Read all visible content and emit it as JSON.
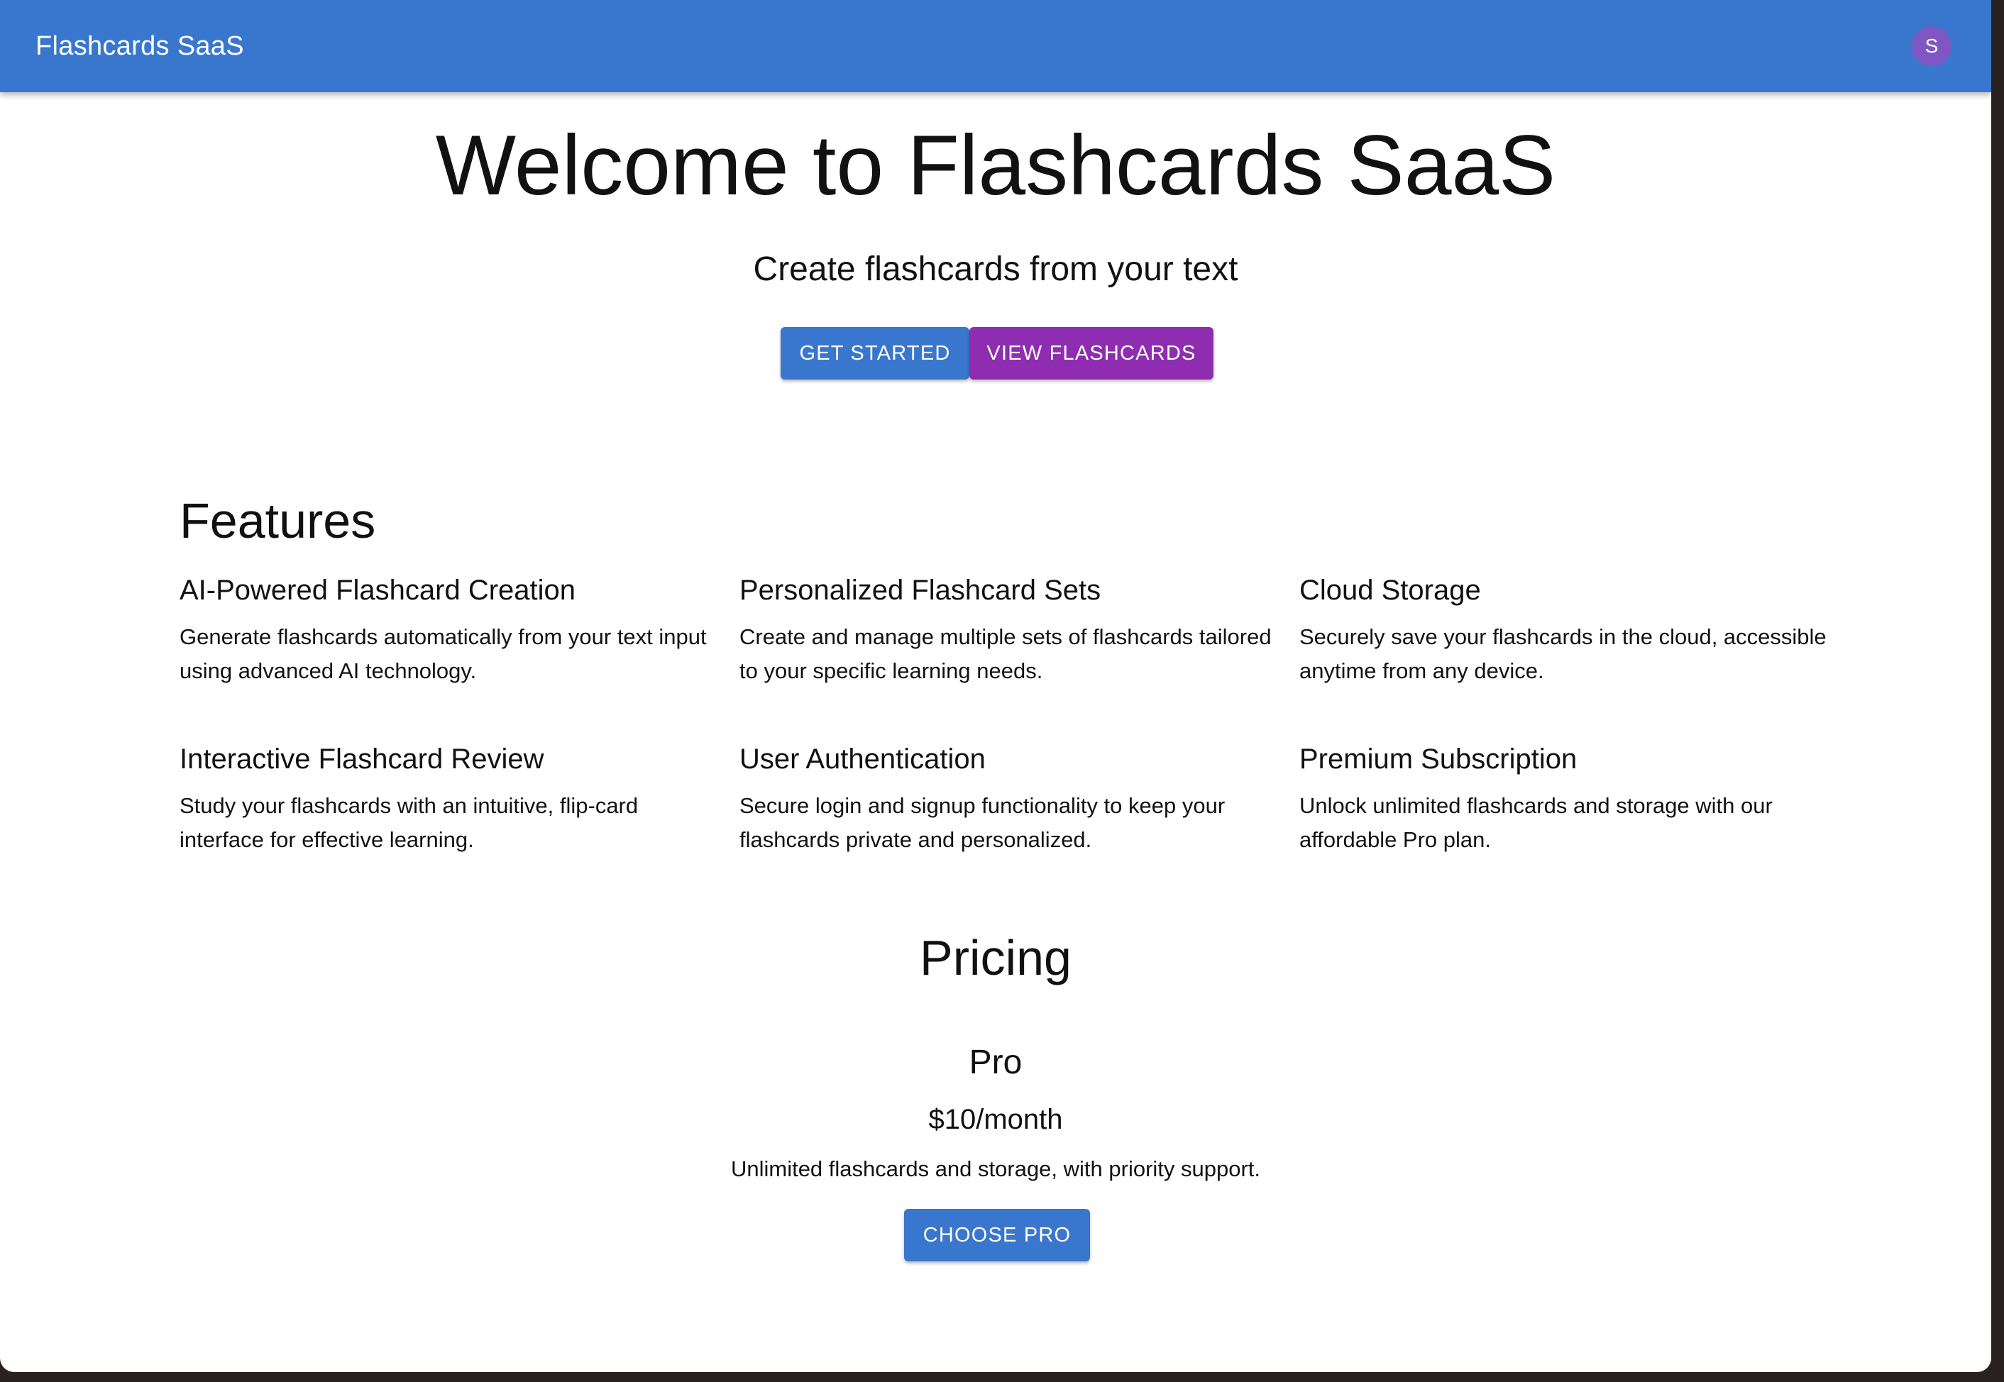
{
  "appbar": {
    "title": "Flashcards SaaS",
    "avatar_initial": "S"
  },
  "hero": {
    "title": "Welcome to Flashcards SaaS",
    "subtitle": "Create flashcards from your text",
    "get_started_label": "Get Started",
    "view_flashcards_label": "View Flashcards"
  },
  "features": {
    "heading": "Features",
    "items": [
      {
        "title": "AI-Powered Flashcard Creation",
        "description": "Generate flashcards automatically from your text input using advanced AI technology."
      },
      {
        "title": "Personalized Flashcard Sets",
        "description": "Create and manage multiple sets of flashcards tailored to your specific learning needs."
      },
      {
        "title": "Cloud Storage",
        "description": "Securely save your flashcards in the cloud, accessible anytime from any device."
      },
      {
        "title": "Interactive Flashcard Review",
        "description": "Study your flashcards with an intuitive, flip-card interface for effective learning."
      },
      {
        "title": "User Authentication",
        "description": "Secure login and signup functionality to keep your flashcards private and personalized."
      },
      {
        "title": "Premium Subscription",
        "description": "Unlock unlimited flashcards and storage with our affordable Pro plan."
      }
    ]
  },
  "pricing": {
    "heading": "Pricing",
    "plan_name": "Pro",
    "price": "$10/month",
    "description": "Unlimited flashcards and storage, with priority support.",
    "choose_label": "Choose Pro"
  },
  "colors": {
    "primary": "#3976ce",
    "secondary": "#8e2db0",
    "avatar": "#7e57c2"
  }
}
